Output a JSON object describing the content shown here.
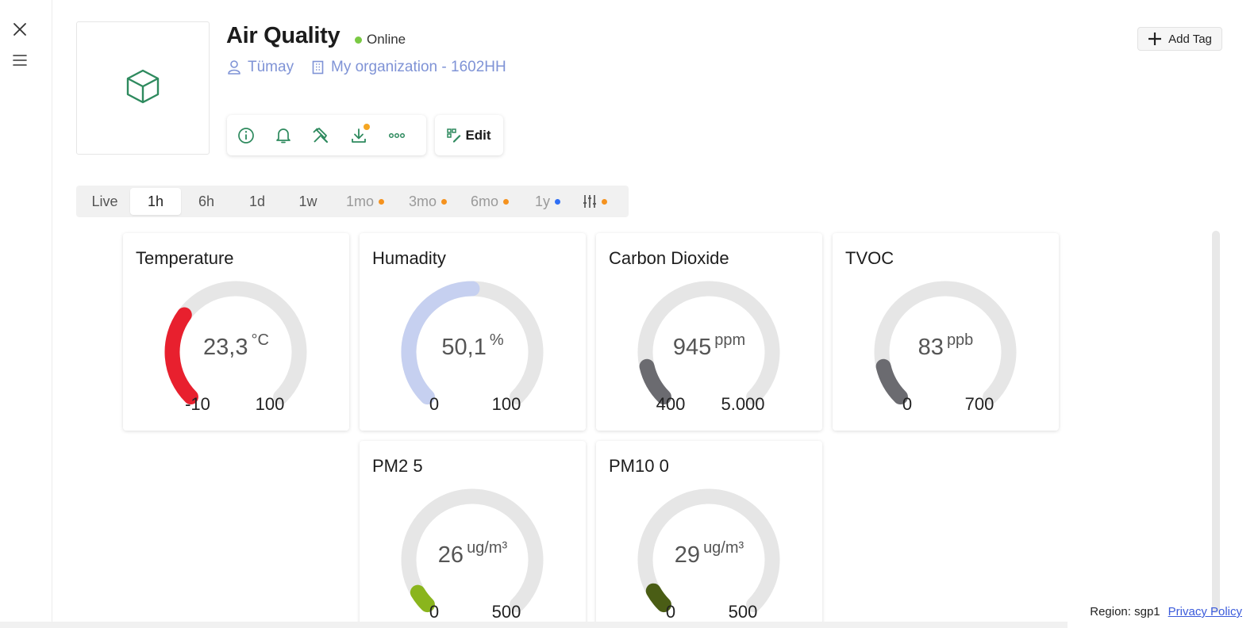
{
  "device": {
    "title": "Air Quality",
    "status": "Online",
    "status_color": "#7ac943",
    "owner": "Tümay",
    "organization": "My organization - 1602HH",
    "icon": "cube-icon"
  },
  "toolbar": {
    "icons": [
      "info-icon",
      "bell-icon",
      "tools-icon",
      "download-icon",
      "more-icon"
    ],
    "download_badge_color": "#f5a623",
    "edit_label": "Edit"
  },
  "add_tag_label": "Add Tag",
  "time_ranges": [
    {
      "label": "Live"
    },
    {
      "label": "1h",
      "active": true
    },
    {
      "label": "6h"
    },
    {
      "label": "1d"
    },
    {
      "label": "1w"
    },
    {
      "label": "1mo",
      "dot": "#f5921e"
    },
    {
      "label": "3mo",
      "dot": "#f5921e"
    },
    {
      "label": "6mo",
      "dot": "#f5921e"
    },
    {
      "label": "1y",
      "dot": "#2f6ff5"
    },
    {
      "label": "",
      "icon": "sliders-icon",
      "dot": "#f5921e"
    }
  ],
  "gauges": [
    {
      "title": "Temperature",
      "value": "23,3",
      "unit": "°C",
      "min": "-10",
      "max": "100",
      "fraction": 0.3,
      "color": "#e8202e"
    },
    {
      "title": "Humadity",
      "value": "50,1",
      "unit": "%",
      "min": "0",
      "max": "100",
      "fraction": 0.5,
      "color": "#c6d0f0"
    },
    {
      "title": "Carbon Dioxide",
      "value": "945",
      "unit": "ppm",
      "min": "400",
      "max": "5.000",
      "fraction": 0.118,
      "color": "#6b6b70"
    },
    {
      "title": "TVOC",
      "value": "83",
      "unit": "ppb",
      "min": "0",
      "max": "700",
      "fraction": 0.118,
      "color": "#6b6b70"
    },
    {
      "title": "PM2 5",
      "value": "26",
      "unit": "ug/m³",
      "min": "0",
      "max": "500",
      "fraction": 0.052,
      "color": "#8ab51d"
    },
    {
      "title": "PM10 0",
      "value": "29",
      "unit": "ug/m³",
      "min": "0",
      "max": "500",
      "fraction": 0.058,
      "color": "#4a5d15"
    }
  ],
  "footer": {
    "region": "Region: sgp1",
    "privacy": "Privacy Policy"
  }
}
